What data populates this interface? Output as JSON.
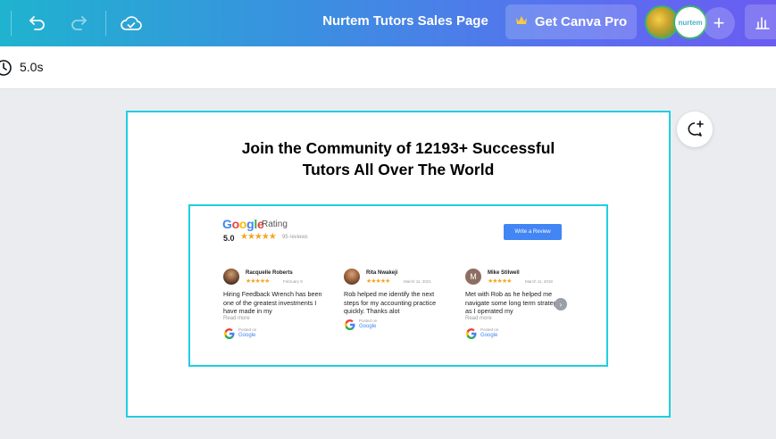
{
  "topbar": {
    "title": "Nurtem Tutors Sales Page",
    "pro_label": "Get Canva Pro",
    "icons": [
      "undo-icon",
      "redo-icon",
      "cloud-saved-icon",
      "crown-icon",
      "plus-icon",
      "analytics-icon"
    ],
    "avatar2_text": "nurtem"
  },
  "subbar": {
    "duration": "5.0s"
  },
  "page": {
    "headline_line1": "Join the Community of 12193+ Successful",
    "headline_line2": "Tutors All Over The World"
  },
  "widget": {
    "rating_word": "Rating",
    "score": "5.0",
    "stars": "★★★★★",
    "review_count": "95 reviews",
    "write_button": "Write a Review",
    "reviews": [
      {
        "name": "Racquelle Roberts",
        "date": "February 9",
        "text": "Hiring Feedback Wrench has been one of the greatest investments I have made in my",
        "more": "Read more",
        "posted_on": "Posted on",
        "source": "Google"
      },
      {
        "name": "Rita Nwakeji",
        "date": "March 11, 2021",
        "text": "Rob helped me identify the next steps for my accounting practice quickly. Thanks alot",
        "more": "",
        "posted_on": "Posted on",
        "source": "Google"
      },
      {
        "name": "Mike Stilwell",
        "initial": "M",
        "date": "March 11, 2018",
        "text": "Met with Rob as he helped me navigate some long term strategies as I operated my",
        "more": "Read more",
        "posted_on": "Posted on",
        "source": "Google"
      }
    ]
  },
  "colors": {
    "selection": "#1fcfe0",
    "star": "#f5a623",
    "google_blue": "#4285f4"
  }
}
